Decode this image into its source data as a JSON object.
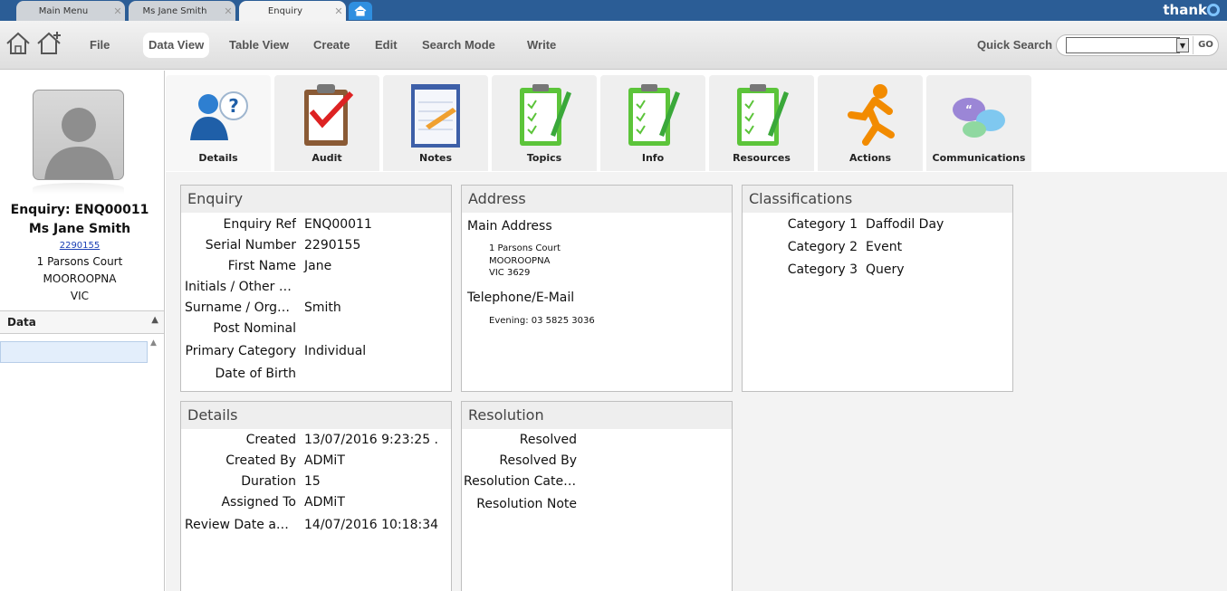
{
  "tabs": [
    {
      "label": "Main Menu"
    },
    {
      "label": "Ms Jane Smith"
    },
    {
      "label": "Enquiry"
    }
  ],
  "brand": {
    "name": "thank"
  },
  "menu": {
    "file": "File",
    "data_view": "Data View",
    "table_view": "Table View",
    "create": "Create",
    "edit": "Edit",
    "search_mode": "Search Mode",
    "write": "Write"
  },
  "quick_search": {
    "label": "Quick Search",
    "value": "",
    "go": "GO"
  },
  "left_panel": {
    "title": "Enquiry: ENQ00011",
    "name": "Ms Jane  Smith",
    "serial": "2290155",
    "address": [
      "1 Parsons Court",
      "MOOROOPNA",
      "VIC"
    ],
    "data_header": "Data"
  },
  "modules": [
    {
      "label": "Details",
      "icon": "person-question-icon"
    },
    {
      "label": "Audit",
      "icon": "clipboard-check-icon"
    },
    {
      "label": "Notes",
      "icon": "notepad-icon"
    },
    {
      "label": "Topics",
      "icon": "checklist-icon"
    },
    {
      "label": "Info",
      "icon": "checklist-icon"
    },
    {
      "label": "Resources",
      "icon": "checklist-icon"
    },
    {
      "label": "Actions",
      "icon": "running-man-icon"
    },
    {
      "label": "Communications",
      "icon": "speech-bubbles-icon"
    }
  ],
  "enquiry_panel": {
    "title": "Enquiry",
    "fields": [
      {
        "label": "Enquiry Ref",
        "value": "ENQ00011"
      },
      {
        "label": "Serial Number",
        "value": "2290155"
      },
      {
        "label": "First Name",
        "value": "Jane"
      },
      {
        "label": "Initials / Other Na...",
        "value": ""
      },
      {
        "label": "Surname / Organi...",
        "value": "Smith"
      },
      {
        "label": "Post Nominal",
        "value": ""
      },
      {
        "label": "Primary  Category",
        "value": "Individual"
      },
      {
        "label": "Date of Birth",
        "value": ""
      }
    ]
  },
  "address_panel": {
    "title": "Address",
    "main_heading": "Main Address",
    "main_lines": [
      "1 Parsons Court",
      "MOOROOPNA",
      "VIC 3629"
    ],
    "phone_heading": "Telephone/E-Mail",
    "phone_line": "Evening: 03 5825 3036"
  },
  "classifications_panel": {
    "title": "Classifications",
    "fields": [
      {
        "label": "Category 1",
        "value": "Daffodil Day"
      },
      {
        "label": "Category 2",
        "value": "Event"
      },
      {
        "label": "Category 3",
        "value": "Query"
      }
    ]
  },
  "details_panel": {
    "title": "Details",
    "fields": [
      {
        "label": "Created",
        "value": "13/07/2016 9:23:25 ."
      },
      {
        "label": "Created By",
        "value": "ADMiT"
      },
      {
        "label": "Duration",
        "value": "15"
      },
      {
        "label": "Assigned To",
        "value": "ADMiT"
      },
      {
        "label": "Review Date and...",
        "value": "14/07/2016 10:18:34"
      }
    ]
  },
  "resolution_panel": {
    "title": "Resolution",
    "fields": [
      {
        "label": "Resolved"
      },
      {
        "label": "Resolved By"
      },
      {
        "label": "Resolution Category"
      },
      {
        "label": "Resolution Note"
      }
    ]
  },
  "colors": {
    "tab_bar": "#2b5d96",
    "new_tab": "#2f8fe0",
    "link": "#1a3fb5",
    "checklist_green": "#5cc43a",
    "actions_orange": "#f28b00"
  }
}
